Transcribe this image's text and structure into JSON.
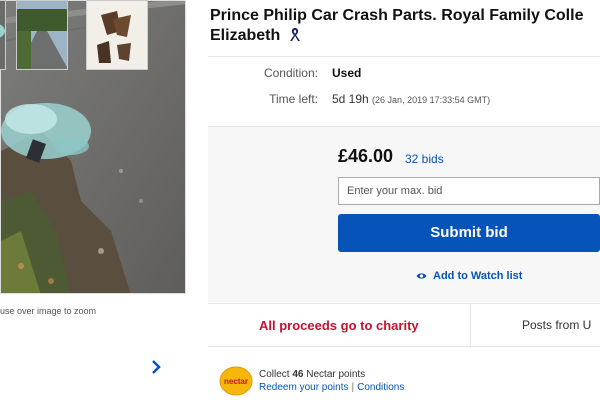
{
  "gallery": {
    "zoom_hint": "use over image to zoom",
    "thumbnails": [
      "road-photo",
      "street-photo",
      "parts-photo"
    ],
    "next_icon": "chevron-right-icon"
  },
  "listing": {
    "title_line1": "Prince Philip Car Crash Parts. Royal Family Colle",
    "title_line2": "Elizabeth",
    "ribbon_icon": "awareness-ribbon-icon"
  },
  "details": {
    "condition_label": "Condition:",
    "condition_value": "Used",
    "time_left_label": "Time left:",
    "time_left_value": "5d 19h",
    "time_left_end": "(26 Jan, 2019   17:33:54 GMT)"
  },
  "bidding": {
    "price": "£46.00",
    "bids": "32 bids",
    "max_bid_placeholder": "Enter your max. bid",
    "submit_label": "Submit bid",
    "watch_label": "Add to Watch list",
    "watch_icon": "eye-icon"
  },
  "info_row": {
    "charity": "All proceeds go to charity",
    "posts_from": "Posts from U"
  },
  "nectar": {
    "logo_text": "nectar",
    "collect_prefix": "Collect ",
    "points": "46",
    "collect_suffix": " Nectar points",
    "redeem_link": "Redeem your points",
    "separator": "|",
    "conditions_link": "Conditions"
  },
  "colors": {
    "link_blue": "#0654ba",
    "charity_red": "#c4122f",
    "nectar_yellow": "#f5b70a"
  }
}
